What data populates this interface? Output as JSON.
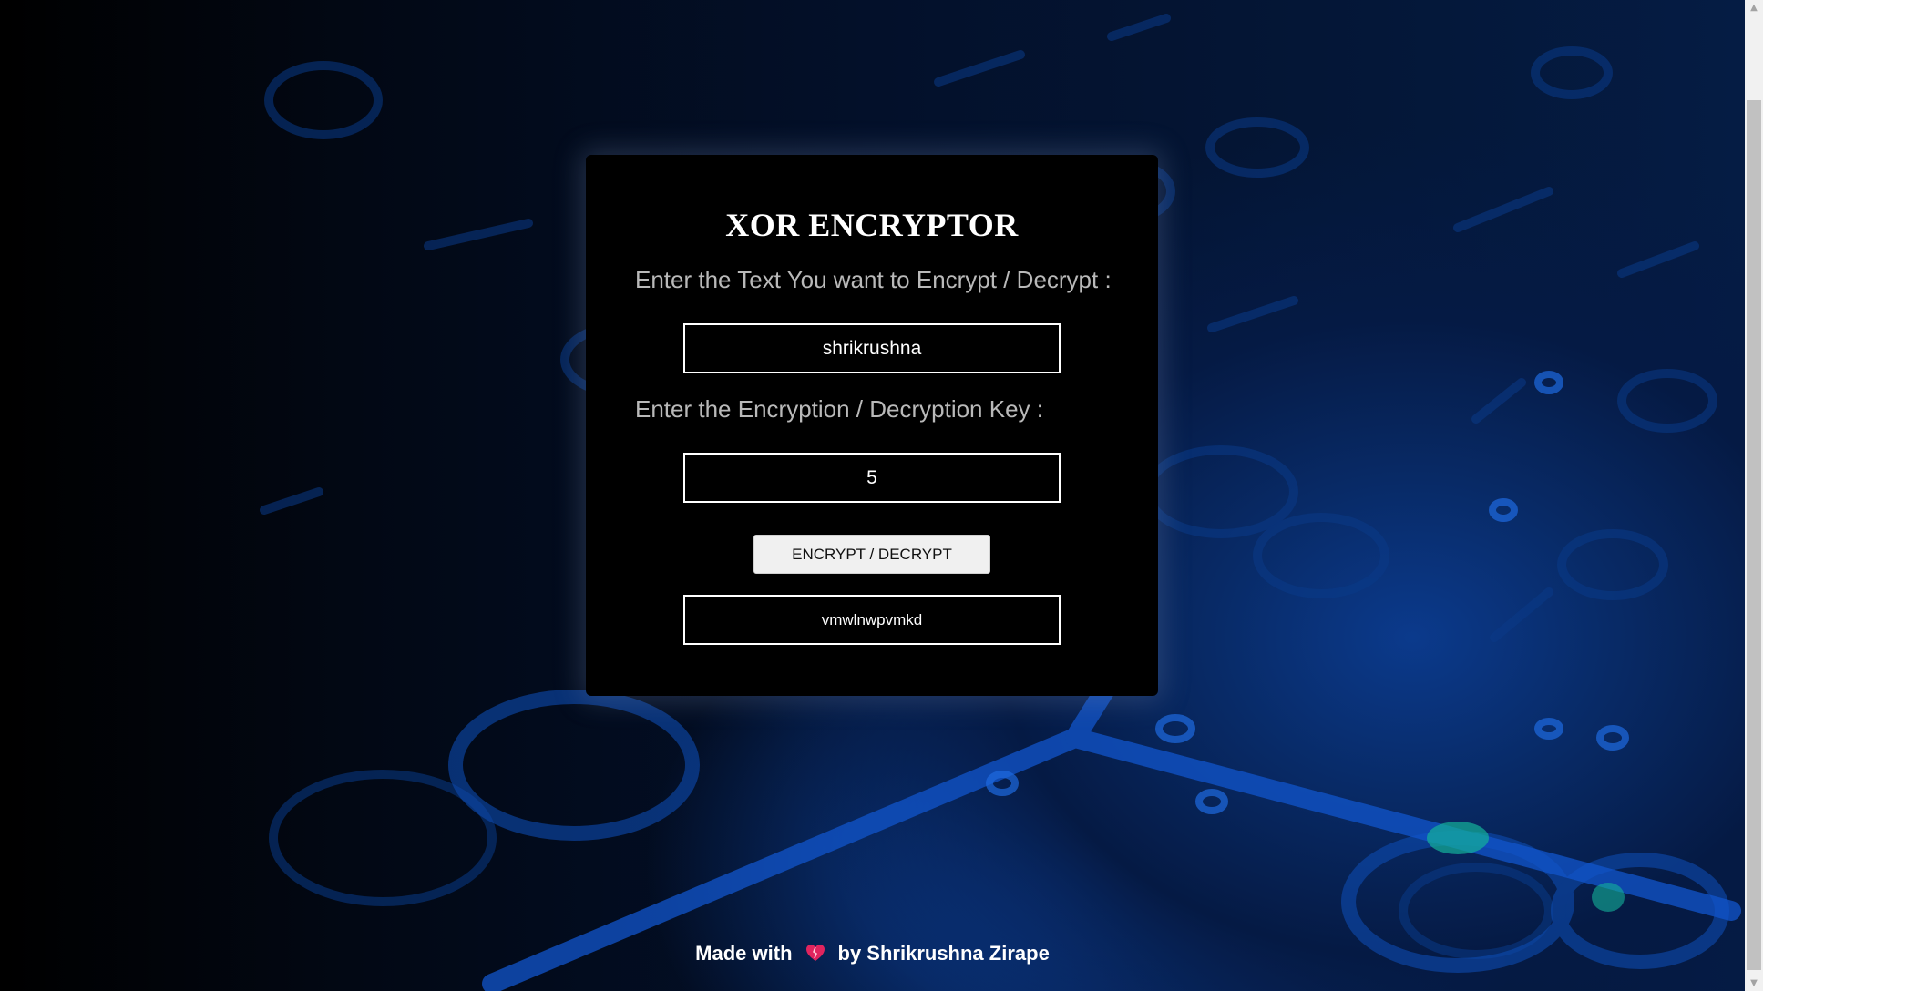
{
  "app": {
    "title": "XOR ENCRYPTOR",
    "text_label": "Enter the Text You want to Encrypt / Decrypt :",
    "text_value": "shrikrushna",
    "key_label": "Enter the Encryption / Decryption Key :",
    "key_value": "5",
    "button_label": "ENCRYPT / DECRYPT",
    "output_value": "vmwlnwpvmkd"
  },
  "footer": {
    "made_with": "Made with",
    "by": "by Shrikrushna Zirape",
    "icon": "heart-icon"
  },
  "colors": {
    "card_bg": "#000000",
    "text": "#ffffff",
    "label": "#b9b9b9",
    "accent_blue": "#0b3a8c",
    "heart": "#e0245e"
  }
}
